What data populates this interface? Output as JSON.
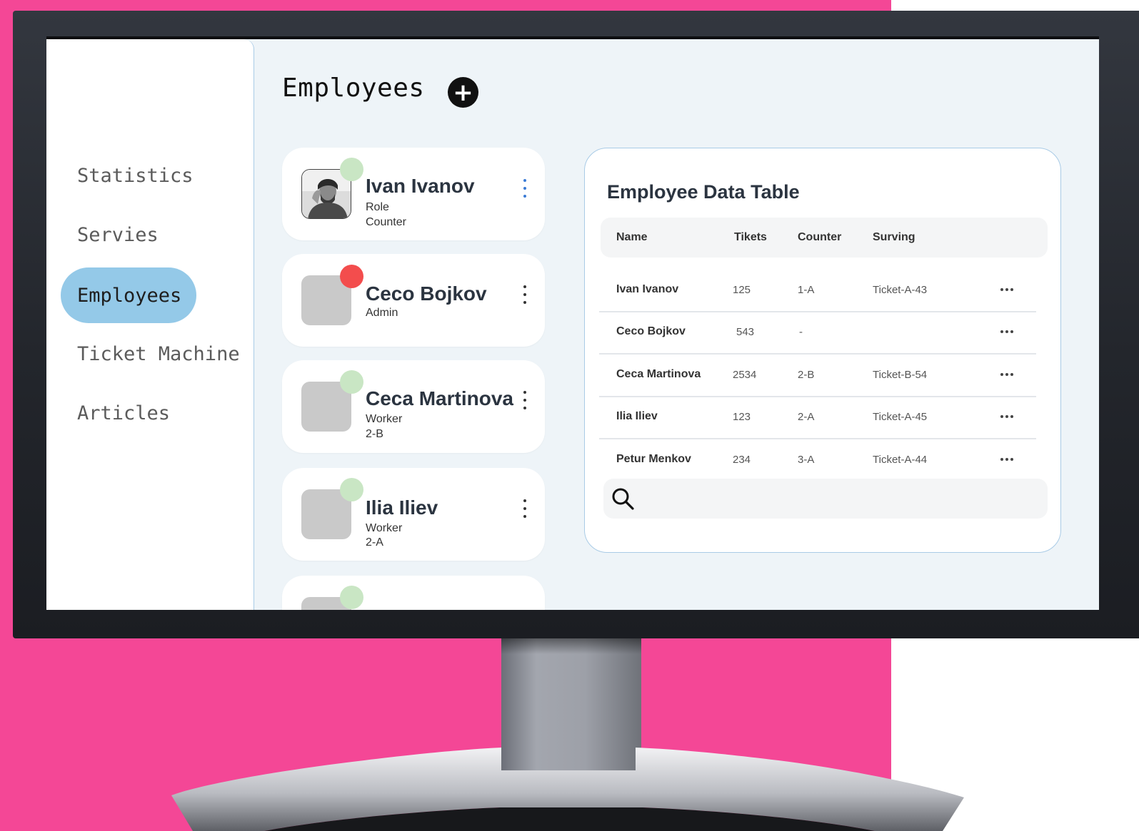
{
  "page": {
    "title": "Employees",
    "add_icon": "plus-circle-icon"
  },
  "colors": {
    "accent": "#94c9e8",
    "online": "#c9e6c4",
    "offline": "#f34d4d",
    "background": "#f44796"
  },
  "sidebar": {
    "items": [
      {
        "label": "Statistics",
        "active": false
      },
      {
        "label": "Servies",
        "active": false
      },
      {
        "label": "Employees",
        "active": true
      },
      {
        "label": "Ticket Machine",
        "active": false
      },
      {
        "label": "Articles",
        "active": false
      }
    ]
  },
  "employees": [
    {
      "name": "Ivan Ivanov",
      "line1": "Role",
      "line2": "Counter",
      "status": "online",
      "photo": true
    },
    {
      "name": "Ceco Bojkov",
      "line1": "Admin",
      "line2": "",
      "status": "offline",
      "photo": false
    },
    {
      "name": "Ceca Martinova",
      "line1": "Worker",
      "line2": "2-B",
      "status": "online",
      "photo": false
    },
    {
      "name": "Ilia Iliev",
      "line1": "Worker",
      "line2": "2-A",
      "status": "online",
      "photo": false
    },
    {
      "name": "",
      "line1": "",
      "line2": "",
      "status": "online",
      "photo": false
    }
  ],
  "table": {
    "title": "Employee Data Table",
    "columns": [
      "Name",
      "Tikets",
      "Counter",
      "Surving"
    ],
    "rows": [
      [
        "Ivan Ivanov",
        "125",
        "1-A",
        "Ticket-A-43"
      ],
      [
        "Ceco Bojkov",
        "543",
        "-",
        ""
      ],
      [
        "Ceca Martinova",
        "2534",
        "2-B",
        "Ticket-B-54"
      ],
      [
        "Ilia Iliev",
        "123",
        "2-A",
        "Ticket-A-45"
      ],
      [
        "Petur Menkov",
        "234",
        "3-A",
        "Ticket-A-44"
      ]
    ],
    "row_action_icon": "more-horizontal-icon",
    "search_icon": "search-icon",
    "search_placeholder": ""
  }
}
